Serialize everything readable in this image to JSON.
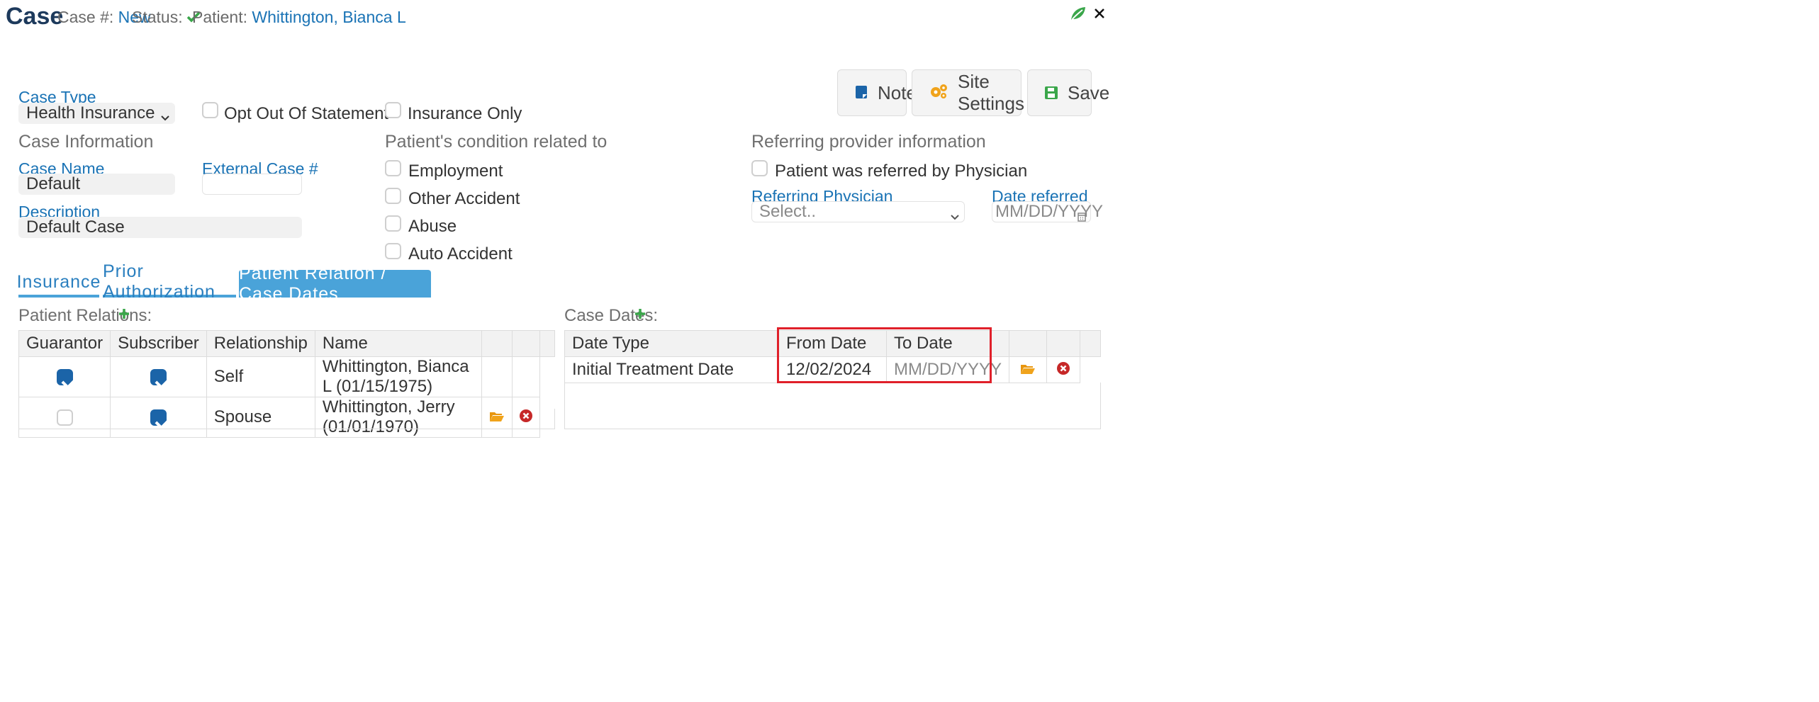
{
  "header": {
    "title": "Case",
    "case_no_label": "Case #:",
    "case_no_value": "New",
    "status_label": "Status:",
    "patient_label": "Patient:",
    "patient_value": "Whittington, Bianca L"
  },
  "toolbar": {
    "notes": "Notes",
    "site_settings": "Site Settings",
    "save": "Save"
  },
  "form": {
    "case_type_label": "Case Type",
    "case_type_value": "Health Insurance",
    "opt_out_label": "Opt Out Of Statement",
    "insurance_only_label": "Insurance Only",
    "case_info_heading": "Case Information",
    "case_name_label": "Case Name",
    "case_name_value": "Default",
    "external_case_label": "External Case #",
    "external_case_value": "",
    "description_label": "Description",
    "description_value": "Default Case",
    "condition_heading": "Patient's condition related to",
    "conditions": [
      "Employment",
      "Other Accident",
      "Abuse",
      "Auto Accident"
    ],
    "referring_heading": "Referring provider information",
    "referred_label": "Patient was referred by Physician",
    "referring_physician_label": "Referring Physician",
    "referring_physician_placeholder": "Select..",
    "date_referred_label": "Date referred",
    "date_referred_placeholder": "MM/DD/YYYY"
  },
  "tabs": [
    "Insurance",
    "Prior Authorization",
    "Patient Relation / Case Dates"
  ],
  "relations": {
    "heading": "Patient Relations:",
    "columns": [
      "Guarantor",
      "Subscriber",
      "Relationship",
      "Name"
    ],
    "rows": [
      {
        "guarantor": true,
        "subscriber": true,
        "relationship": "Self",
        "name": "Whittington, Bianca L (01/15/1975)"
      },
      {
        "guarantor": false,
        "subscriber": true,
        "relationship": "Spouse",
        "name": "Whittington, Jerry (01/01/1970)"
      }
    ]
  },
  "case_dates": {
    "heading": "Case Dates:",
    "columns": [
      "Date Type",
      "From Date",
      "To Date"
    ],
    "rows": [
      {
        "date_type": "Initial Treatment Date",
        "from_date": "12/02/2024",
        "to_date_placeholder": "MM/DD/YYYY"
      }
    ]
  },
  "colors": {
    "accent_blue": "#1a73b5",
    "tab_active": "#4aa3d9",
    "check_blue": "#1b64a8",
    "add_green": "#3aa64a",
    "folder_orange": "#f0a31b",
    "delete_red": "#c62828",
    "highlight_red": "#e0202a"
  }
}
